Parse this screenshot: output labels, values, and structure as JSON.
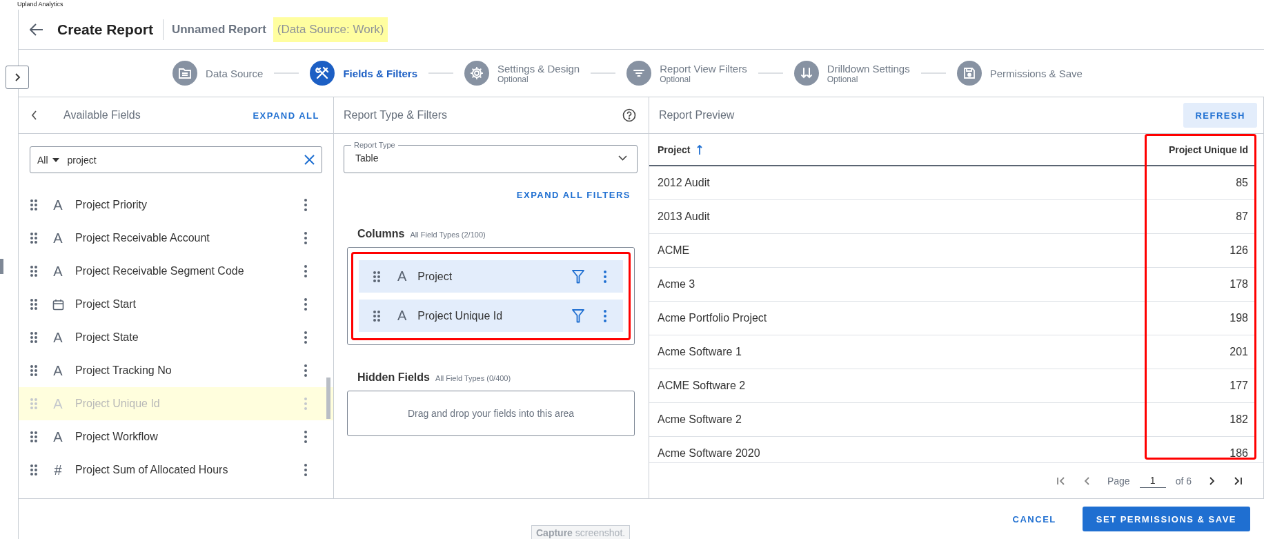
{
  "app_name": "Upland Analytics",
  "header": {
    "title": "Create Report",
    "report_name": "Unnamed Report",
    "data_source": {
      "text": "(Data Source: Work)",
      "highlighted": true
    }
  },
  "steps": [
    {
      "kind": "datasource",
      "label": "Data Source",
      "selected": false
    },
    {
      "kind": "fields",
      "label": "Fields & Filters",
      "selected": true
    },
    {
      "kind": "settings",
      "label": "Settings & Design",
      "sublabel": "Optional",
      "selected": false
    },
    {
      "kind": "filters",
      "label": "Report View Filters",
      "sublabel": "Optional",
      "selected": false
    },
    {
      "kind": "drilldown",
      "label": "Drilldown Settings",
      "sublabel": "Optional",
      "selected": false
    },
    {
      "kind": "permissions",
      "label": "Permissions & Save",
      "selected": false
    }
  ],
  "fields_panel": {
    "title": "Available Fields",
    "expand_label": "EXPAND ALL",
    "search": {
      "scope": "All",
      "value": "project"
    },
    "items": [
      {
        "kind": "text",
        "symbol": "A",
        "label": "Project Priority",
        "disabled": false,
        "highlighted": false
      },
      {
        "kind": "text",
        "symbol": "A",
        "label": "Project Receivable Account",
        "disabled": false,
        "highlighted": false
      },
      {
        "kind": "text",
        "symbol": "A",
        "label": "Project Receivable Segment Code",
        "disabled": false,
        "highlighted": false
      },
      {
        "kind": "date",
        "label": "Project Start",
        "disabled": false,
        "highlighted": false
      },
      {
        "kind": "text",
        "symbol": "A",
        "label": "Project State",
        "disabled": false,
        "highlighted": false
      },
      {
        "kind": "text",
        "symbol": "A",
        "label": "Project Tracking No",
        "disabled": false,
        "highlighted": false
      },
      {
        "kind": "text",
        "symbol": "A",
        "label": "Project Unique Id",
        "disabled": true,
        "highlighted": true
      },
      {
        "kind": "text",
        "symbol": "A",
        "label": "Project Workflow",
        "disabled": false,
        "highlighted": false
      },
      {
        "kind": "number",
        "symbol": "#",
        "label": "Project Sum of Allocated Hours",
        "disabled": false,
        "highlighted": false
      }
    ]
  },
  "filters_panel": {
    "title": "Report Type & Filters",
    "report_type": {
      "label": "Report Type",
      "value": "Table"
    },
    "expand_filters_label": "EXPAND ALL FILTERS",
    "columns": {
      "title": "Columns",
      "subtitle": "All Field Types (2/100)",
      "outlined": true,
      "items": [
        {
          "symbol": "A",
          "label": "Project"
        },
        {
          "symbol": "A",
          "label": "Project Unique Id"
        }
      ]
    },
    "hidden_fields": {
      "title": "Hidden Fields",
      "subtitle": "All Field Types (0/400)",
      "placeholder": "Drag and drop your fields into this area"
    }
  },
  "preview_panel": {
    "title": "Report Preview",
    "refresh_label": "REFRESH",
    "table": {
      "columns": [
        {
          "label": "Project",
          "kind": "text",
          "sort_ascending": true,
          "outlined": false
        },
        {
          "label": "Project Unique Id",
          "kind": "number",
          "sort_ascending": false,
          "outlined": true
        }
      ],
      "rows": [
        [
          "2012 Audit",
          "85"
        ],
        [
          "2013 Audit",
          "87"
        ],
        [
          "ACME",
          "126"
        ],
        [
          "Acme 3",
          "178"
        ],
        [
          "Acme Portfolio Project",
          "198"
        ],
        [
          "Acme Software 1",
          "201"
        ],
        [
          "ACME Software 2",
          "177"
        ],
        [
          "Acme Software 2",
          "182"
        ],
        [
          "Acme Software 2020",
          "186"
        ]
      ]
    },
    "pagination": {
      "page_label": "Page",
      "page": "1",
      "of_label": "of 6"
    }
  },
  "footer": {
    "cancel_label": "CANCEL",
    "save_label": "SET PERMISSIONS & SAVE"
  },
  "capture_tooltip": "**Capture** screenshot."
}
